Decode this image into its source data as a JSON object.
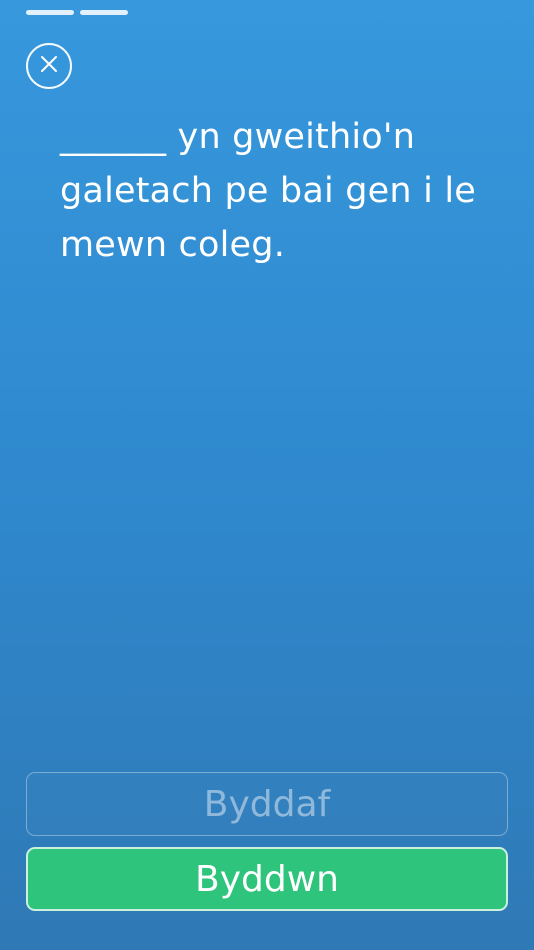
{
  "progress": {
    "segments": 2
  },
  "close": {
    "icon": "close-icon"
  },
  "question": {
    "text": "______ yn gweithio'n galetach pe bai gen i le mewn coleg."
  },
  "answers": [
    {
      "label": "Byddaf",
      "state": "disabled"
    },
    {
      "label": "Byddwn",
      "state": "correct"
    }
  ],
  "colors": {
    "background_top": "#3798dd",
    "background_bottom": "#2f79b5",
    "correct": "#2ec47b"
  }
}
